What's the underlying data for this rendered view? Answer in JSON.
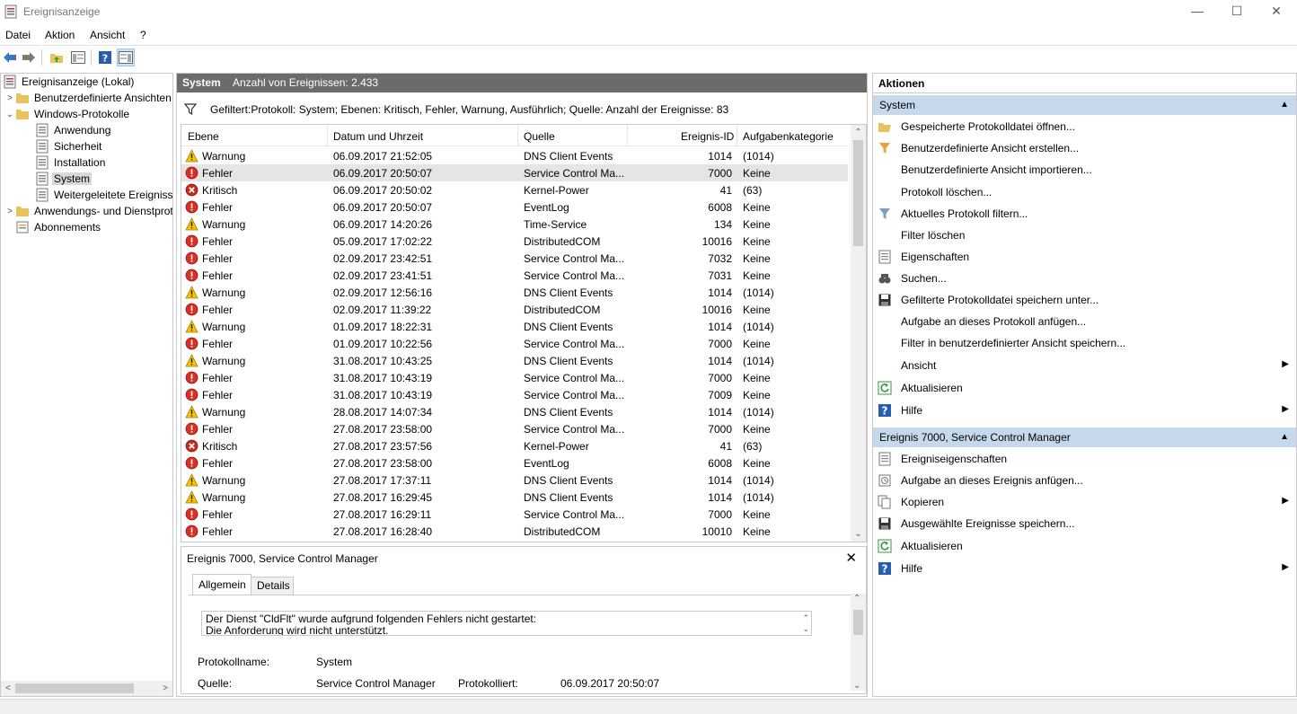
{
  "window": {
    "title": "Ereignisanzeige",
    "controls": {
      "minimize": "—",
      "maximize": "☐",
      "close": "✕"
    }
  },
  "menu": [
    "Datei",
    "Aktion",
    "Ansicht",
    "?"
  ],
  "toolbar": [
    "back-arrow-icon",
    "forward-arrow-icon",
    "folder-up-icon",
    "show-hide-tree-icon",
    "help-icon",
    "show-hide-action-pane-icon"
  ],
  "tree": {
    "root": "Ereignisanzeige (Lokal)",
    "custom_views": "Benutzerdefinierte Ansichten",
    "windows_logs": "Windows-Protokolle",
    "logs": [
      "Anwendung",
      "Sicherheit",
      "Installation",
      "System",
      "Weitergeleitete Ereignisse"
    ],
    "app_services": "Anwendungs- und Dienstprotokolle",
    "subscriptions": "Abonnements"
  },
  "center": {
    "header_title": "System",
    "header_count": "Anzahl von Ereignissen: 2.433",
    "filter_text": "Gefiltert:Protokoll: System; Ebenen: Kritisch, Fehler, Warnung, Ausführlich; Quelle:  Anzahl der Ereignisse: 83",
    "columns": {
      "level": "Ebene",
      "datetime": "Datum und Uhrzeit",
      "source": "Quelle",
      "event_id": "Ereignis-ID",
      "task": "Aufgabenkategorie"
    },
    "rows": [
      {
        "level": "Warnung",
        "icon": "warning",
        "datetime": "06.09.2017 21:52:05",
        "source": "DNS Client Events",
        "id": "1014",
        "task": "(1014)"
      },
      {
        "level": "Fehler",
        "icon": "error",
        "datetime": "06.09.2017 20:50:07",
        "source": "Service Control Ma...",
        "id": "7000",
        "task": "Keine"
      },
      {
        "level": "Kritisch",
        "icon": "critical",
        "datetime": "06.09.2017 20:50:02",
        "source": "Kernel-Power",
        "id": "41",
        "task": "(63)"
      },
      {
        "level": "Fehler",
        "icon": "error",
        "datetime": "06.09.2017 20:50:07",
        "source": "EventLog",
        "id": "6008",
        "task": "Keine"
      },
      {
        "level": "Warnung",
        "icon": "warning",
        "datetime": "06.09.2017 14:20:26",
        "source": "Time-Service",
        "id": "134",
        "task": "Keine"
      },
      {
        "level": "Fehler",
        "icon": "error",
        "datetime": "05.09.2017 17:02:22",
        "source": "DistributedCOM",
        "id": "10016",
        "task": "Keine"
      },
      {
        "level": "Fehler",
        "icon": "error",
        "datetime": "02.09.2017 23:42:51",
        "source": "Service Control Ma...",
        "id": "7032",
        "task": "Keine"
      },
      {
        "level": "Fehler",
        "icon": "error",
        "datetime": "02.09.2017 23:41:51",
        "source": "Service Control Ma...",
        "id": "7031",
        "task": "Keine"
      },
      {
        "level": "Warnung",
        "icon": "warning",
        "datetime": "02.09.2017 12:56:16",
        "source": "DNS Client Events",
        "id": "1014",
        "task": "(1014)"
      },
      {
        "level": "Fehler",
        "icon": "error",
        "datetime": "02.09.2017 11:39:22",
        "source": "DistributedCOM",
        "id": "10016",
        "task": "Keine"
      },
      {
        "level": "Warnung",
        "icon": "warning",
        "datetime": "01.09.2017 18:22:31",
        "source": "DNS Client Events",
        "id": "1014",
        "task": "(1014)"
      },
      {
        "level": "Fehler",
        "icon": "error",
        "datetime": "01.09.2017 10:22:56",
        "source": "Service Control Ma...",
        "id": "7000",
        "task": "Keine"
      },
      {
        "level": "Warnung",
        "icon": "warning",
        "datetime": "31.08.2017 10:43:25",
        "source": "DNS Client Events",
        "id": "1014",
        "task": "(1014)"
      },
      {
        "level": "Fehler",
        "icon": "error",
        "datetime": "31.08.2017 10:43:19",
        "source": "Service Control Ma...",
        "id": "7000",
        "task": "Keine"
      },
      {
        "level": "Fehler",
        "icon": "error",
        "datetime": "31.08.2017 10:43:19",
        "source": "Service Control Ma...",
        "id": "7009",
        "task": "Keine"
      },
      {
        "level": "Warnung",
        "icon": "warning",
        "datetime": "28.08.2017 14:07:34",
        "source": "DNS Client Events",
        "id": "1014",
        "task": "(1014)"
      },
      {
        "level": "Fehler",
        "icon": "error",
        "datetime": "27.08.2017 23:58:00",
        "source": "Service Control Ma...",
        "id": "7000",
        "task": "Keine"
      },
      {
        "level": "Kritisch",
        "icon": "critical",
        "datetime": "27.08.2017 23:57:56",
        "source": "Kernel-Power",
        "id": "41",
        "task": "(63)"
      },
      {
        "level": "Fehler",
        "icon": "error",
        "datetime": "27.08.2017 23:58:00",
        "source": "EventLog",
        "id": "6008",
        "task": "Keine"
      },
      {
        "level": "Warnung",
        "icon": "warning",
        "datetime": "27.08.2017 17:37:11",
        "source": "DNS Client Events",
        "id": "1014",
        "task": "(1014)"
      },
      {
        "level": "Warnung",
        "icon": "warning",
        "datetime": "27.08.2017 16:29:45",
        "source": "DNS Client Events",
        "id": "1014",
        "task": "(1014)"
      },
      {
        "level": "Fehler",
        "icon": "error",
        "datetime": "27.08.2017 16:29:11",
        "source": "Service Control Ma...",
        "id": "7000",
        "task": "Keine"
      },
      {
        "level": "Fehler",
        "icon": "error",
        "datetime": "27.08.2017 16:28:40",
        "source": "DistributedCOM",
        "id": "10010",
        "task": "Keine"
      }
    ]
  },
  "detail": {
    "title": "Ereignis 7000, Service Control Manager",
    "tabs": [
      "Allgemein",
      "Details"
    ],
    "message_line1": "Der Dienst \"CldFlt\" wurde aufgrund folgenden Fehlers nicht gestartet:",
    "message_line2": "Die Anforderung wird nicht unterstützt.",
    "log_name_label": "Protokollname:",
    "log_name_value": "System",
    "source_label": "Quelle:",
    "source_value": "Service Control Manager",
    "logged_label": "Protokolliert:",
    "logged_value": "06.09.2017 20:50:07"
  },
  "actions": {
    "header": "Aktionen",
    "section1": "System",
    "items1": [
      {
        "label": "Gespeicherte Protokolldatei öffnen...",
        "icon": "open-log-icon"
      },
      {
        "label": "Benutzerdefinierte Ansicht erstellen...",
        "icon": "create-view-icon"
      },
      {
        "label": "Benutzerdefinierte Ansicht importieren...",
        "icon": ""
      },
      {
        "label": "Protokoll löschen...",
        "icon": ""
      },
      {
        "label": "Aktuelles Protokoll filtern...",
        "icon": "filter-icon"
      },
      {
        "label": "Filter löschen",
        "icon": ""
      },
      {
        "label": "Eigenschaften",
        "icon": "properties-icon"
      },
      {
        "label": "Suchen...",
        "icon": "find-icon"
      },
      {
        "label": "Gefilterte Protokolldatei speichern unter...",
        "icon": "save-icon"
      },
      {
        "label": "Aufgabe an dieses Protokoll anfügen...",
        "icon": ""
      },
      {
        "label": "Filter in benutzerdefinierter Ansicht speichern...",
        "icon": ""
      },
      {
        "label": "Ansicht",
        "icon": "",
        "submenu": true
      },
      {
        "label": "Aktualisieren",
        "icon": "refresh-icon"
      },
      {
        "label": "Hilfe",
        "icon": "help-icon",
        "submenu": true
      }
    ],
    "section2": "Ereignis 7000, Service Control Manager",
    "items2": [
      {
        "label": "Ereigniseigenschaften",
        "icon": "event-properties-icon"
      },
      {
        "label": "Aufgabe an dieses Ereignis anfügen...",
        "icon": "attach-task-icon"
      },
      {
        "label": "Kopieren",
        "icon": "copy-icon",
        "submenu": true
      },
      {
        "label": "Ausgewählte Ereignisse speichern...",
        "icon": "save-icon"
      },
      {
        "label": "Aktualisieren",
        "icon": "refresh-icon"
      },
      {
        "label": "Hilfe",
        "icon": "help-icon",
        "submenu": true
      }
    ]
  },
  "colors": {
    "header_gray": "#6b6b6b",
    "section_blue": "#c6d9ec",
    "selected_row": "#e5e5e5",
    "warning_yellow": "#f5c400",
    "error_red": "#d93025"
  }
}
